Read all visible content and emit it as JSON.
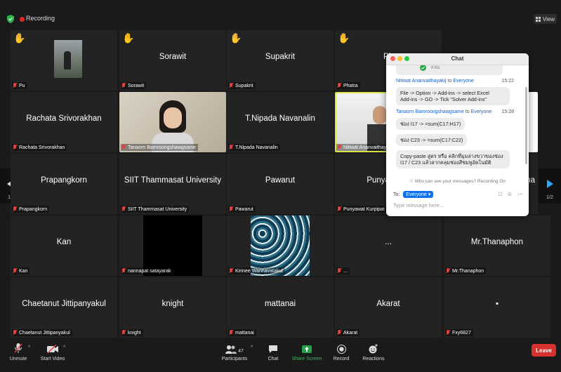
{
  "recording_label": "Recording",
  "view_label": "View",
  "page_indicator": "1/2",
  "tiles": [
    {
      "label": "Pu",
      "display": "",
      "hand": true
    },
    {
      "label": "Sorawit",
      "display": "Sorawit",
      "hand": true
    },
    {
      "label": "Supakrit",
      "display": "Supakrit",
      "hand": true
    },
    {
      "label": "Phatra",
      "display": "Ph",
      "hand": true
    },
    {
      "label": "Rachata Srivorakhan",
      "display": "Rachata Srivorakhan",
      "hand": false
    },
    {
      "label": "Tanaorn Bamroongshawgsame",
      "display": "",
      "hand": false
    },
    {
      "label": "T.Nipada Navanalin",
      "display": "T.Nipada Navanalin",
      "hand": false
    },
    {
      "label": "Nitiwat Ananvaithayak",
      "display": "",
      "hand": false
    },
    {
      "label": "Prapangkorn",
      "display": "Prapangkorn",
      "hand": false
    },
    {
      "label": "SIIT Thammasat University",
      "display": "SIIT Thammasat University",
      "hand": false
    },
    {
      "label": "Pawarut",
      "display": "Pawarut",
      "hand": false
    },
    {
      "label": "Punyawat Kurpipat",
      "display": "Punyawat K",
      "hand": false
    },
    {
      "label": "Kan",
      "display": "Kan",
      "hand": false
    },
    {
      "label": "nannapat satayarak",
      "display": "",
      "hand": false
    },
    {
      "label": "Kirinee Wannavatakul",
      "display": "",
      "hand": false
    },
    {
      "label": "...",
      "display": "...",
      "hand": false
    },
    {
      "label": "Mr.Thanaphon",
      "display": "Mr.Thanaphon",
      "hand": false
    },
    {
      "label": "Chaetanut Jittipanyakul",
      "display": "Chaetanut Jittipanyakul",
      "hand": false
    },
    {
      "label": "knight",
      "display": "knight",
      "hand": false
    },
    {
      "label": "mattanai",
      "display": "mattanai",
      "hand": false
    },
    {
      "label": "Akarat",
      "display": "Akarat",
      "hand": false
    },
    {
      "label": "Fxy6827",
      "display": "▪",
      "hand": false
    }
  ],
  "partial_right": {
    "display": "ana"
  },
  "chat": {
    "title": "Chat",
    "top_fragment": "ri Ko",
    "msg1_sender": "Nitiwat Ananvaithayakij",
    "msg1_to": "to",
    "msg1_recipient": "Everyone",
    "msg1_time": "15:22",
    "msg1_line1": "File -> Option -> Add-ins -> select Excel",
    "msg1_line2": "Add-ins -> GO -> Tick \"Solver Add-ins\"",
    "msg2_sender": "Tanaorn Bamroongshawgsame",
    "msg2_to": "to",
    "msg2_recipient": "Everyone",
    "msg2_time": "15:28",
    "msg2_b1": "ช่อง I17 -> =sum(C17:H17)",
    "msg2_b2": "ช่อง C23 -> =sum(C17:C22)",
    "msg2_b3_line1": "Copy-paste สูตร หรือ คลิกที่มุมล่างขวาของช่อง",
    "msg2_b3_line2": "I17 / C23 แล้วลากคลุมช่องสีชมพูอัตโนมัติ",
    "who_can_see": "Who can see your messages? Recording On",
    "to_label": "To:",
    "to_value": "Everyone",
    "input_placeholder": "Type message here..."
  },
  "toolbar": {
    "unmute": "Unmute",
    "start_video": "Start Video",
    "participants": "Participants",
    "participants_count": "47",
    "chat": "Chat",
    "share_screen": "Share Screen",
    "record": "Record",
    "reactions": "Reactions",
    "leave": "Leave"
  },
  "colors": {
    "active_speaker": "#d8e24a",
    "share_green": "#24a148",
    "leave_red": "#d8322e",
    "chat_link": "#1a60c8"
  }
}
